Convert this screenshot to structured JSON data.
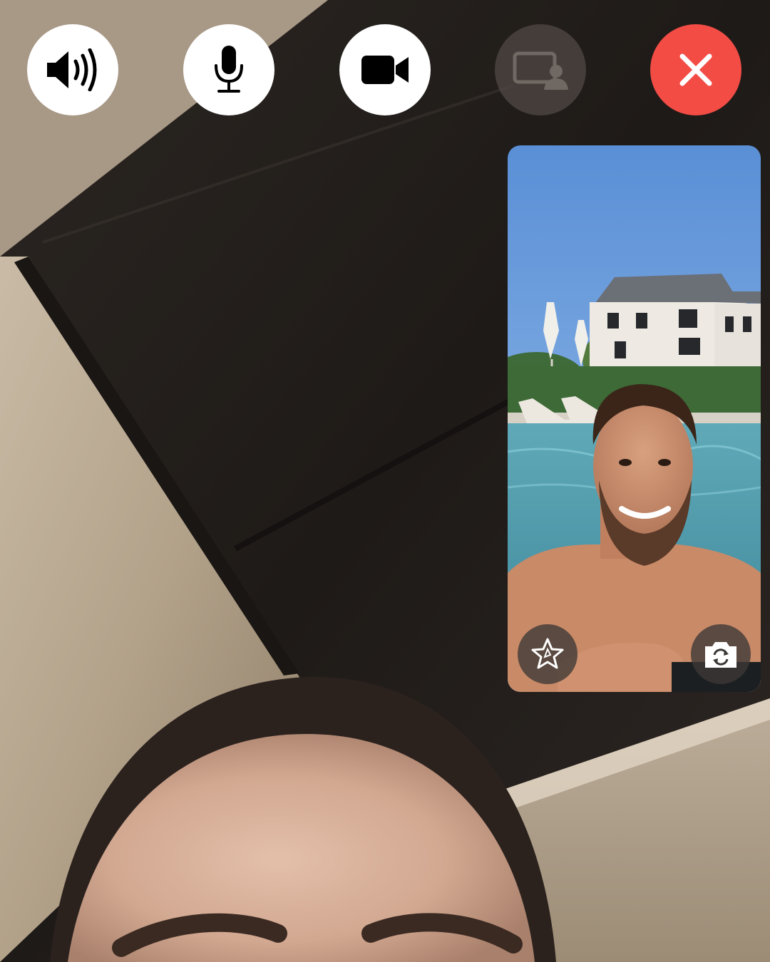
{
  "call": {
    "controls": [
      {
        "name": "speaker",
        "icon": "speaker-icon",
        "state": "on"
      },
      {
        "name": "mute",
        "icon": "microphone-icon",
        "state": "on"
      },
      {
        "name": "camera",
        "icon": "video-camera-icon",
        "state": "on"
      },
      {
        "name": "share-screen",
        "icon": "screen-share-icon",
        "state": "disabled"
      },
      {
        "name": "end-call",
        "icon": "close-icon",
        "color": "#f24c45"
      }
    ],
    "self_view": {
      "effects_icon": "effects-star-icon",
      "flip_icon": "camera-flip-icon"
    }
  },
  "colors": {
    "end_call": "#f24c45",
    "control_bg": "#ffffff",
    "control_disabled_bg": "#4f4844"
  }
}
